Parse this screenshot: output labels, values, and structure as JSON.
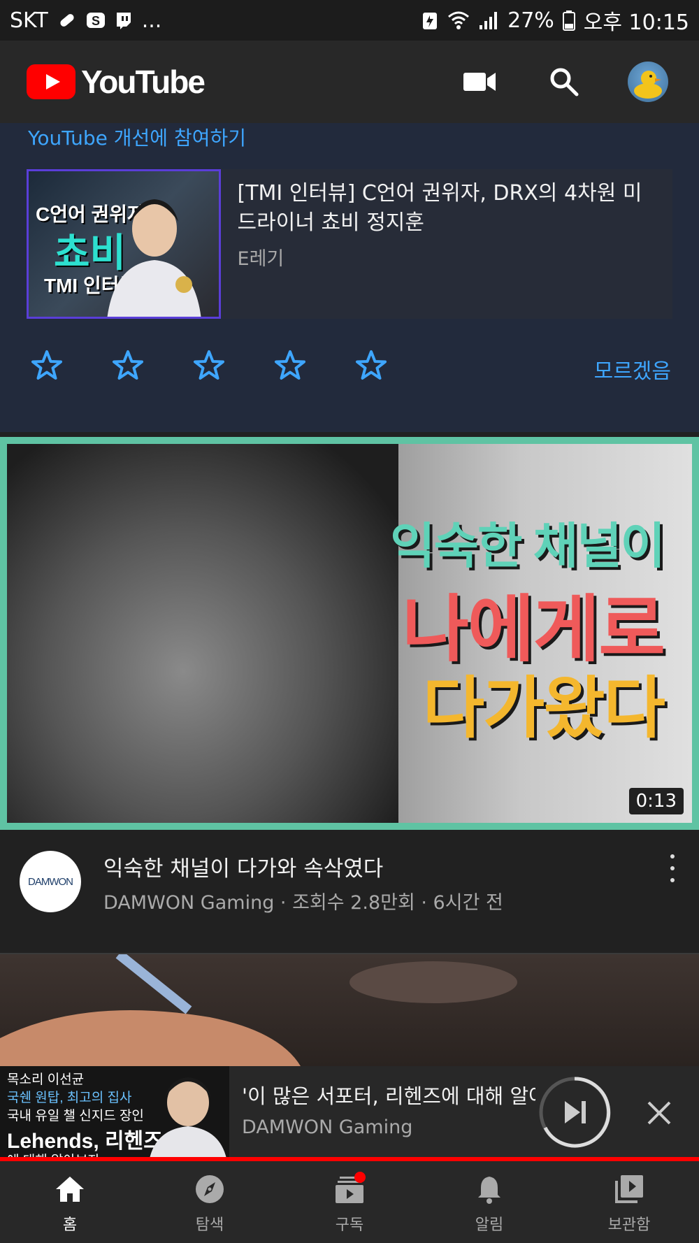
{
  "status_bar": {
    "carrier": "SKT",
    "more": "...",
    "battery": "27%",
    "time": "오후 10:15"
  },
  "header": {
    "logo_text": "YouTube",
    "icons": [
      "video-camera-icon",
      "search-icon",
      "account-avatar"
    ]
  },
  "survey": {
    "link_text": "YouTube 개선에 참여하기",
    "video_title": "[TMI 인터뷰] C언어 권위자, DRX의 4차원 미드라이너 쵸비 정지훈",
    "channel": "E레기",
    "thumb_lines": [
      "C언어 권위자",
      "쵸비",
      "TMI 인터뷰"
    ],
    "rating_max": 5,
    "dont_know_label": "모르겠음"
  },
  "video": {
    "thumb_lines": [
      "익숙한 채널이",
      "나에게로",
      "다가왔다"
    ],
    "duration": "0:13",
    "channel_avatar_text": "DAMWON",
    "title": "익숙한 채널이 다가와 속삭였다",
    "subtitle": "DAMWON Gaming · 조회수 2.8만회 · 6시간 전"
  },
  "miniplayer": {
    "thumb_lines": [
      "목소리 이선균",
      "국쉔 원탑, 최고의 집사",
      "국내 유일 챌 신지드 장인",
      "Lehends, 리헨즈",
      "에 대해 알아보자"
    ],
    "title": "'이 많은 서포터, 리헨즈에 대해 알아",
    "channel": "DAMWON Gaming"
  },
  "bottom_nav": {
    "items": [
      {
        "label": "홈",
        "icon": "home-icon",
        "active": true
      },
      {
        "label": "탐색",
        "icon": "explore-icon",
        "active": false
      },
      {
        "label": "구독",
        "icon": "subscriptions-icon",
        "active": false
      },
      {
        "label": "알림",
        "icon": "bell-icon",
        "active": false
      },
      {
        "label": "보관함",
        "icon": "library-icon",
        "active": false
      }
    ]
  },
  "colors": {
    "accent_blue": "#3ea6ff",
    "brand_red": "#ff0000",
    "highlight_border": "#5fc3a3"
  }
}
